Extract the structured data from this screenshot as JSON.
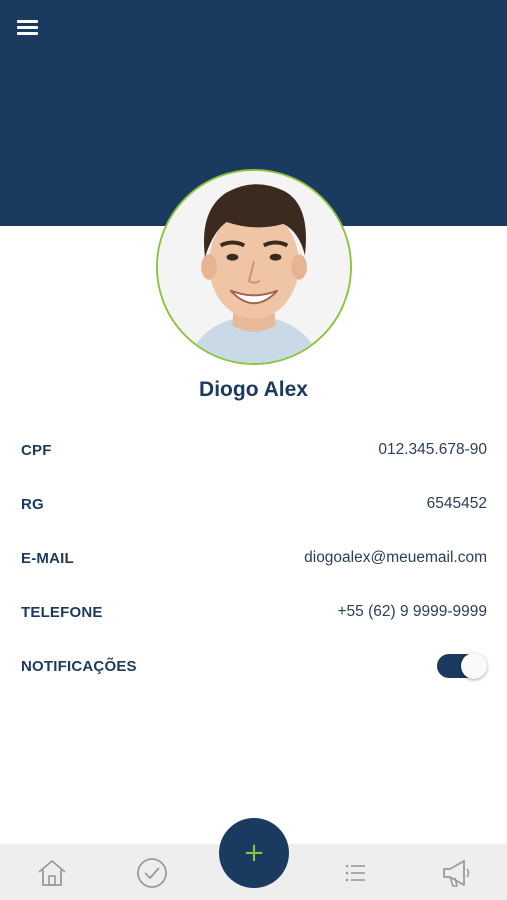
{
  "header": {
    "menu_icon": "hamburger-menu-icon",
    "background": "#1b3a5f"
  },
  "profile": {
    "name": "Diogo Alex",
    "avatar": "profile-photo",
    "avatar_border": "#8cc43f"
  },
  "fields": [
    {
      "label": "CPF",
      "value": "012.345.678-90"
    },
    {
      "label": "RG",
      "value": "6545452"
    },
    {
      "label": "E-MAIL",
      "value": "diogoalex@meuemail.com"
    },
    {
      "label": "TELEFONE",
      "value": "+55 (62) 9 9999-9999"
    }
  ],
  "notifications": {
    "label": "NOTIFICAÇÕES",
    "enabled": true
  },
  "bottom_nav": {
    "items": [
      "home-icon",
      "check-circle-icon",
      "list-icon",
      "megaphone-icon"
    ],
    "fab_label": "+",
    "fab_color": "#8cc43f"
  }
}
